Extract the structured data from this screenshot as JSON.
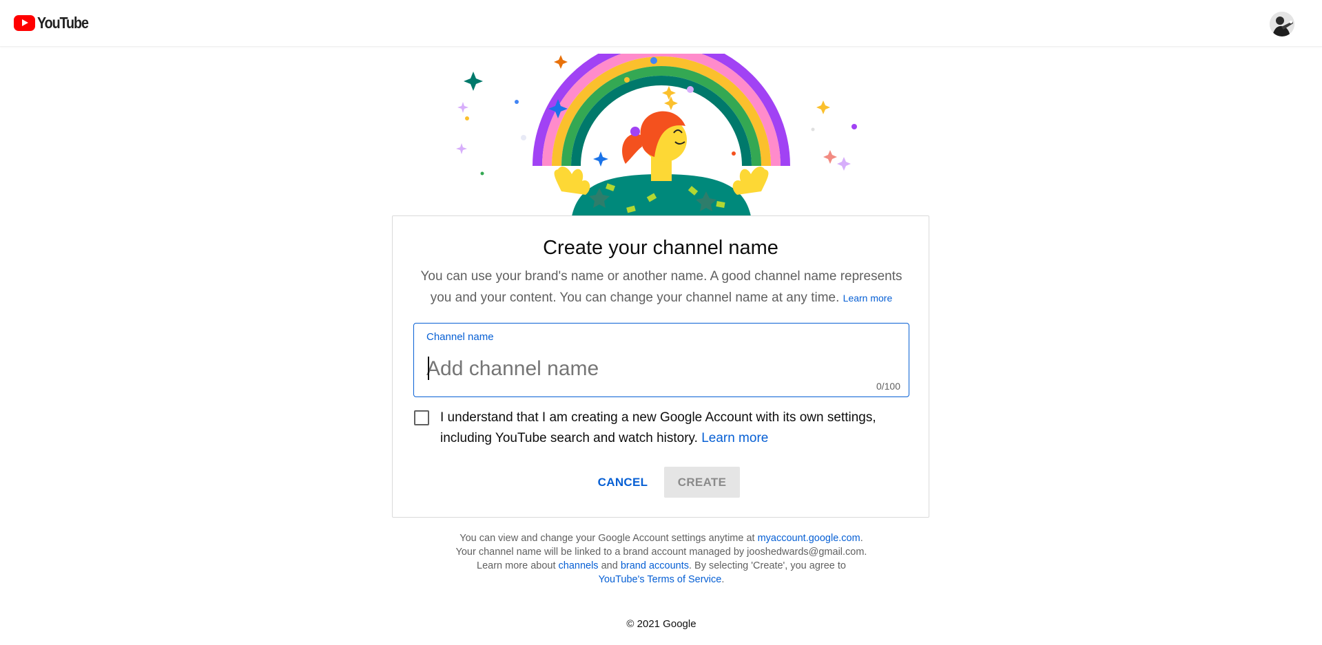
{
  "header": {
    "logo_text": "YouTube",
    "avatar_icon": "user-avatar-icon"
  },
  "dialog": {
    "title": "Create your channel name",
    "description": "You can use your brand's name or another name. A good channel name represents you and your content. You can change your channel name at any time.",
    "description_link": "Learn more",
    "field": {
      "label": "Channel name",
      "placeholder": "Add channel name",
      "value": "",
      "counter": "0/100"
    },
    "checkbox": {
      "checked": false,
      "text": "I understand that I am creating a new Google Account with its own settings, including YouTube search and watch history.",
      "link": "Learn more"
    },
    "buttons": {
      "cancel": "CANCEL",
      "create": "CREATE"
    }
  },
  "footer": {
    "line1_text": "You can view and change your Google Account settings anytime at",
    "line1_link": "myaccount.google.com",
    "line1_end": ".",
    "line2": "Your channel name will be linked to a brand account managed by jooshedwards@gmail.com.",
    "line3_a": "Learn more about",
    "line3_link1": "channels",
    "line3_b": "and",
    "line3_link2": "brand accounts",
    "line3_c": ". By selecting 'Create', you agree to",
    "line4_link": "YouTube's Terms of Service",
    "line4_end": ".",
    "copyright": "© 2021 Google"
  },
  "colors": {
    "brand_red": "#ff0000",
    "link_blue": "#065fd4",
    "disabled_gray": "#e5e5e5"
  }
}
